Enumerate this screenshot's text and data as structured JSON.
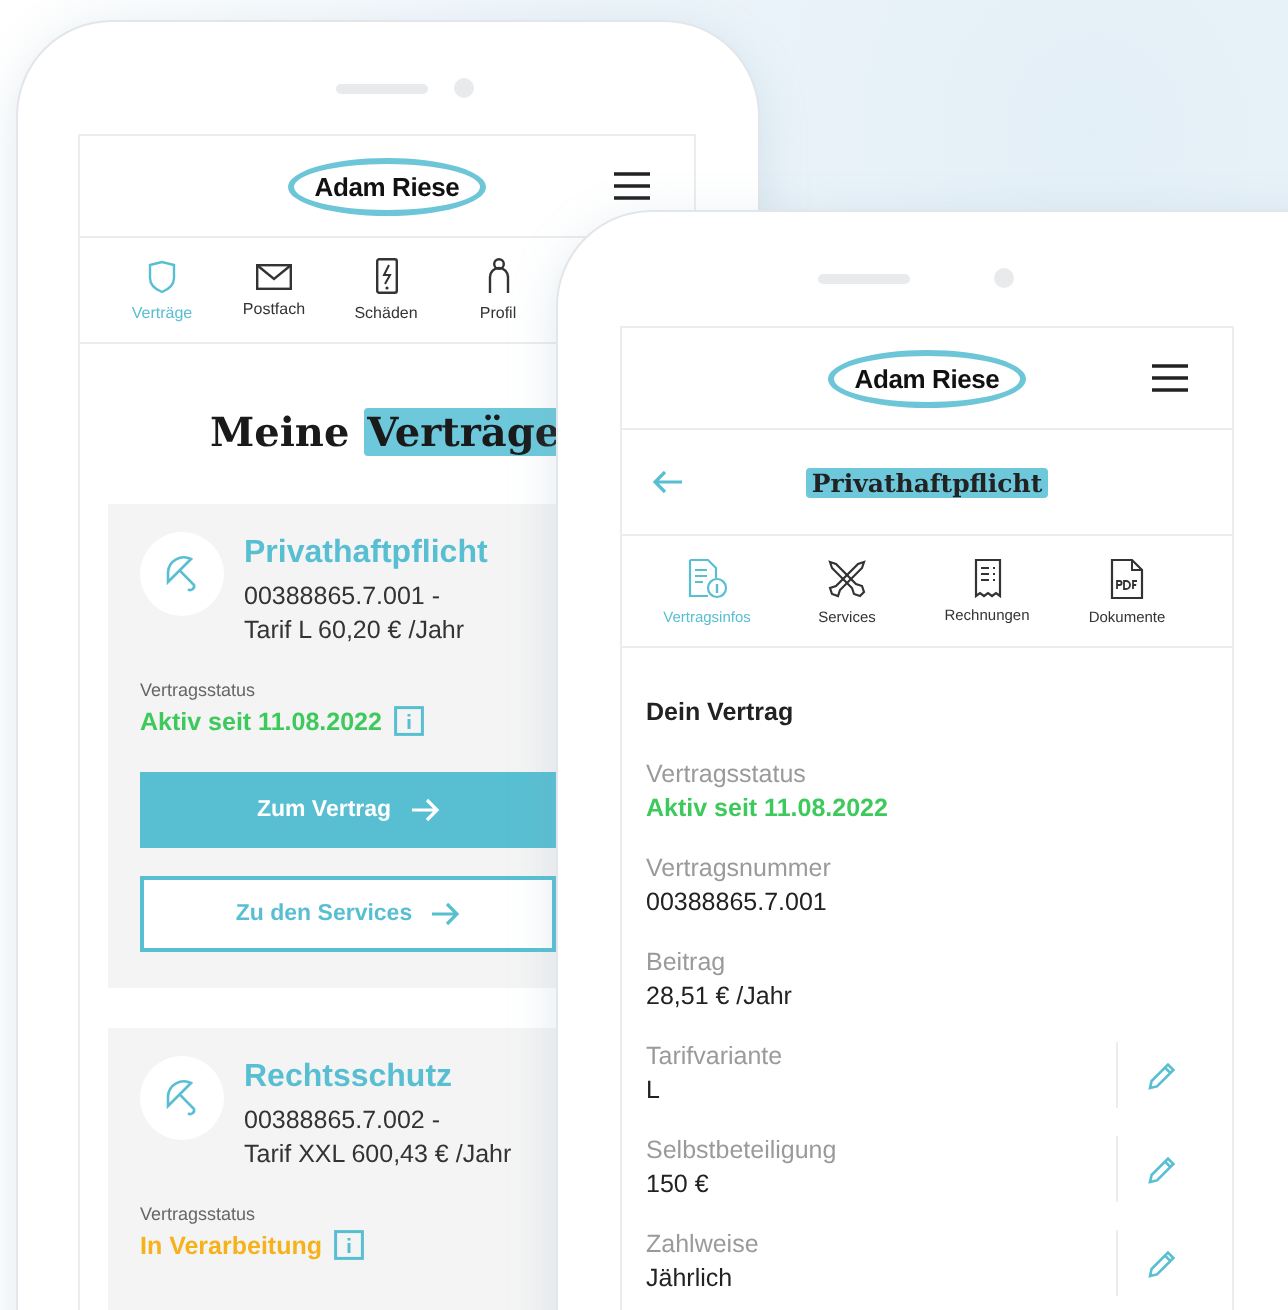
{
  "overview_screen": {
    "logo": "Adam Riese",
    "nav_tabs": [
      {
        "label": "Verträge",
        "kind": "shield",
        "selected": true
      },
      {
        "label": "Postfach",
        "kind": "mail",
        "selected": false
      },
      {
        "label": "Schäden",
        "kind": "phone",
        "selected": false
      },
      {
        "label": "Profil",
        "kind": "person",
        "selected": false
      }
    ],
    "heading_plain": "Meine",
    "heading_highlight": "Verträge",
    "contracts": [
      {
        "name": "Privathaftpflicht",
        "number_line": "00388865.7.001 -",
        "tariff_line": "Tarif L 60,20 € /Jahr",
        "status_label": "Vertragsstatus",
        "status": "Aktiv seit 11.08.2022",
        "color": "#3ec95c",
        "buttons": [
          {
            "label": "Zum Vertrag",
            "kind": "primary"
          },
          {
            "label": "Zu den Services",
            "kind": "secondary"
          }
        ]
      },
      {
        "name": "Rechtsschutz",
        "number_line": "00388865.7.002 -",
        "tariff_line": "Tarif XXL 600,43 € /Jahr",
        "status_label": "Vertragsstatus",
        "status": "In Verarbeitung",
        "color": "#f5b21b"
      }
    ]
  },
  "detail_screen": {
    "logo": "Adam Riese",
    "title": "Privathaftpflicht",
    "tabs": [
      {
        "label": "Vertragsinfos",
        "kind": "info",
        "selected": true
      },
      {
        "label": "Services",
        "kind": "tools",
        "selected": false
      },
      {
        "label": "Rechnungen",
        "kind": "receipt",
        "selected": false
      },
      {
        "label": "Dokumente",
        "kind": "pdf",
        "selected": false
      }
    ],
    "section_title": "Dein Vertrag",
    "fields": [
      {
        "label": "Vertragsstatus",
        "value": "Aktiv seit 11.08.2022",
        "kind": "status",
        "editable": false
      },
      {
        "label": "Vertragsnummer",
        "value": "00388865.7.001",
        "kind": "text",
        "editable": false
      },
      {
        "label": "Beitrag",
        "value": "28,51 € /Jahr",
        "kind": "text",
        "editable": false
      },
      {
        "label": "Tarifvariante",
        "value": "L",
        "kind": "text",
        "editable": true
      },
      {
        "label": "Selbstbeteiligung",
        "value": "150 €",
        "kind": "text",
        "editable": true
      },
      {
        "label": "Zahlweise",
        "value": "Jährlich",
        "kind": "text",
        "editable": true
      }
    ]
  }
}
